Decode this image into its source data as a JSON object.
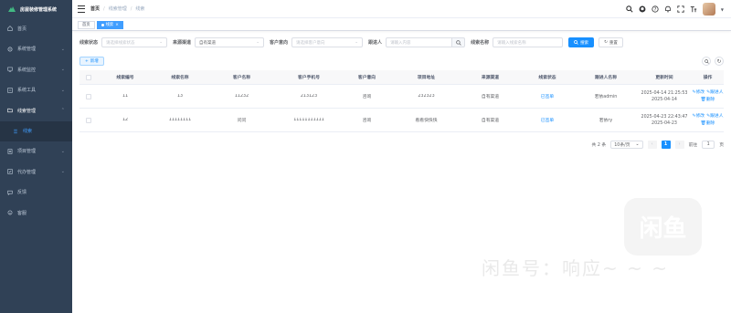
{
  "app": {
    "title": "房屋装修管理系统"
  },
  "sidebar": {
    "items": [
      {
        "label": "首页",
        "icon": "home-icon",
        "has_arrow": false
      },
      {
        "label": "系统管理",
        "icon": "gear-icon",
        "has_arrow": true
      },
      {
        "label": "系统监控",
        "icon": "monitor-icon",
        "has_arrow": true
      },
      {
        "label": "系统工具",
        "icon": "tool-icon",
        "has_arrow": true
      },
      {
        "label": "线索管理",
        "icon": "folder-icon",
        "has_arrow": true,
        "open": true
      },
      {
        "label": "线索",
        "icon": "list-icon",
        "sub": true
      },
      {
        "label": "项目管理",
        "icon": "project-icon",
        "has_arrow": true
      },
      {
        "label": "代办管理",
        "icon": "todo-icon",
        "has_arrow": true
      },
      {
        "label": "反馈",
        "icon": "feedback-icon",
        "has_arrow": false
      },
      {
        "label": "客服",
        "icon": "service-icon",
        "has_arrow": false
      }
    ]
  },
  "header": {
    "breadcrumb": [
      "首页",
      "线索管理",
      "线索"
    ]
  },
  "tags": {
    "items": [
      "首页",
      "线索"
    ]
  },
  "filters": {
    "status_label": "线索状态",
    "status_placeholder": "请选择线索状态",
    "source_label": "来源渠道",
    "source_value": "自有渠道",
    "intent_label": "客户意向",
    "intent_placeholder": "请选择客户意向",
    "follower_label": "跟进人",
    "follower_placeholder": "请输入内容",
    "name_label": "线索名称",
    "name_placeholder": "请输入线索名称",
    "search_label": "搜索",
    "reset_label": "重置"
  },
  "toolbar": {
    "add_label": "新增"
  },
  "table": {
    "columns": [
      "线索编号",
      "线索名称",
      "客户名称",
      "客户手机号",
      "客户意向",
      "项目地址",
      "来源渠道",
      "线索状态",
      "跟进人名称",
      "更新时间",
      "操作"
    ],
    "rows": [
      {
        "id": "11",
        "name": "13",
        "customer": "11232",
        "phone": "213123",
        "intent": "咨询",
        "address": "232323",
        "source": "自有渠道",
        "status": "已签单",
        "follower": "若依admin",
        "updated": "2025-04-14 21:25:53 2025-04-14"
      },
      {
        "id": "12",
        "name": "11111111",
        "customer": "问问",
        "phone": "11111111111",
        "intent": "咨询",
        "address": "看看快快快",
        "source": "自有渠道",
        "status": "已签单",
        "follower": "若依ry",
        "updated": "2025-04-23 22:43:47 2025-04-23"
      }
    ],
    "ops": {
      "edit": "修改",
      "follow": "跟进人",
      "delete": "删除"
    }
  },
  "pager": {
    "total": "共 2 条",
    "page_size": "10条/页",
    "current": "1",
    "jump_prefix": "前往",
    "jump_value": "1",
    "jump_suffix": "页"
  },
  "watermark": {
    "logo": "闲鱼",
    "text": "闲鱼号：响应~ ~ ~"
  }
}
